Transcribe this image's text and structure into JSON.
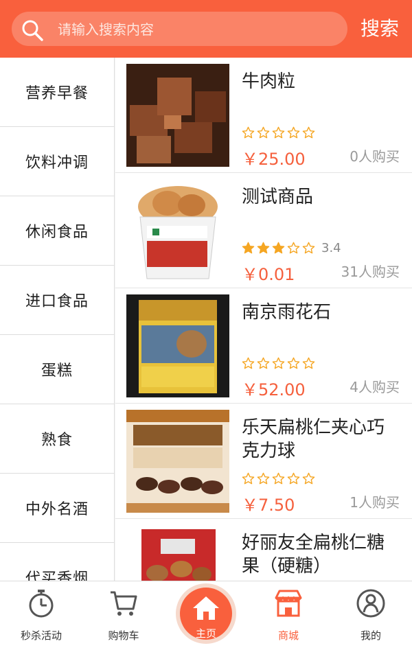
{
  "search": {
    "placeholder": "请输入搜索内容",
    "button_label": "搜索"
  },
  "categories": [
    "营养早餐",
    "饮料冲调",
    "休闲食品",
    "进口食品",
    "蛋糕",
    "熟食",
    "中外名酒",
    "代买香烟"
  ],
  "products": [
    {
      "name": "牛肉粒",
      "rating": 0,
      "rating_text": "",
      "price": "￥25.00",
      "buyers": "0人购买",
      "image": "beef-cubes"
    },
    {
      "name": "测试商品",
      "rating": 3,
      "rating_text": "3.4",
      "price": "￥0.01",
      "buyers": "31人购买",
      "image": "fried-chicken-cup"
    },
    {
      "name": "南京雨花石",
      "rating": 0,
      "rating_text": "",
      "price": "￥52.00",
      "buyers": "4人购买",
      "image": "cigarette-box"
    },
    {
      "name": "乐天扁桃仁夹心巧克力球",
      "rating": 0,
      "rating_text": "",
      "price": "￥7.50",
      "buyers": "1人购买",
      "image": "almond-chocolate"
    },
    {
      "name": "好丽友全扁桃仁糖果（硬糖）",
      "rating": 0,
      "rating_text": "",
      "price": "",
      "buyers": "",
      "image": "almond-candy-bag"
    }
  ],
  "nav": {
    "items": [
      {
        "label": "秒杀活动",
        "icon": "stopwatch-icon"
      },
      {
        "label": "购物车",
        "icon": "cart-icon"
      },
      {
        "label": "主页",
        "icon": "home-icon"
      },
      {
        "label": "商城",
        "icon": "store-icon"
      },
      {
        "label": "我的",
        "icon": "user-icon"
      }
    ],
    "active": "主页"
  },
  "colors": {
    "brand": "#f9603d",
    "star": "#f5a623",
    "price": "#f5603d"
  }
}
